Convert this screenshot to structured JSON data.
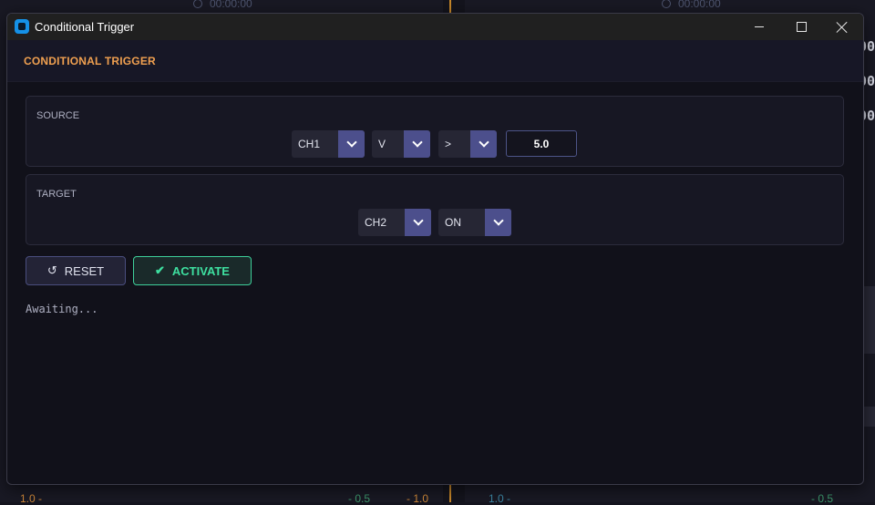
{
  "background": {
    "left_time": "00:00:00",
    "right_time": "00:00:00",
    "edge_labels": [
      "00",
      "00",
      "00"
    ],
    "bottom_ticks_left": [
      "1.0 -",
      "- 0.5",
      "- 1.0"
    ],
    "bottom_ticks_right": [
      "1.0 -",
      "- 0.5"
    ]
  },
  "window": {
    "title": "Conditional Trigger",
    "header": "CONDITIONAL TRIGGER"
  },
  "source": {
    "label": "SOURCE",
    "channel": "CH1",
    "unit": "V",
    "operator": ">",
    "threshold": "5.0"
  },
  "target": {
    "label": "TARGET",
    "channel": "CH2",
    "state": "ON"
  },
  "buttons": {
    "reset_icon": "↺",
    "reset_label": "RESET",
    "activate_icon": "✔",
    "activate_label": "ACTIVATE"
  },
  "status": "Awaiting...",
  "colors": {
    "accent": "#f0a050",
    "activate": "#3ee0a0",
    "combo_arrow": "#4c4f8c"
  }
}
